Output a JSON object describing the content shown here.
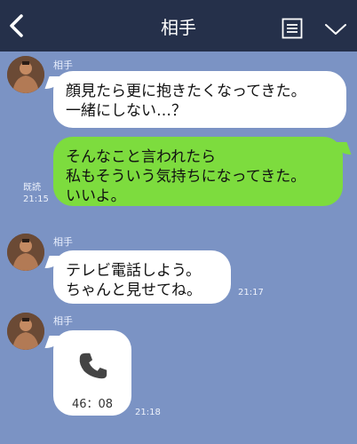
{
  "header": {
    "title": "相手",
    "icons": [
      "back-chevron-icon",
      "list-icon",
      "chevron-down-icon"
    ],
    "background": "#25304a"
  },
  "chat": {
    "background": "#7b93c4",
    "messages": [
      {
        "sender": "相手",
        "side": "left",
        "text": "顔見たら更に抱きたくなってきた。\n一緒にしない…？",
        "time": ""
      },
      {
        "sender": "me",
        "side": "right",
        "read": "既読",
        "text": "そんなこと言われたら\n私もそういう気持ちになってきた。\nいいよ。",
        "time": "21:15"
      },
      {
        "sender": "相手",
        "side": "left",
        "text": "テレビ電話しよう。\nちゃんと見せてね。",
        "time": "21:17"
      },
      {
        "sender": "相手",
        "side": "left",
        "type": "call",
        "icon": "phone-icon",
        "duration": "46：08",
        "time": "21:18"
      }
    ],
    "bubble_colors": {
      "received": "#ffffff",
      "sent": "#7ddc3e"
    }
  }
}
